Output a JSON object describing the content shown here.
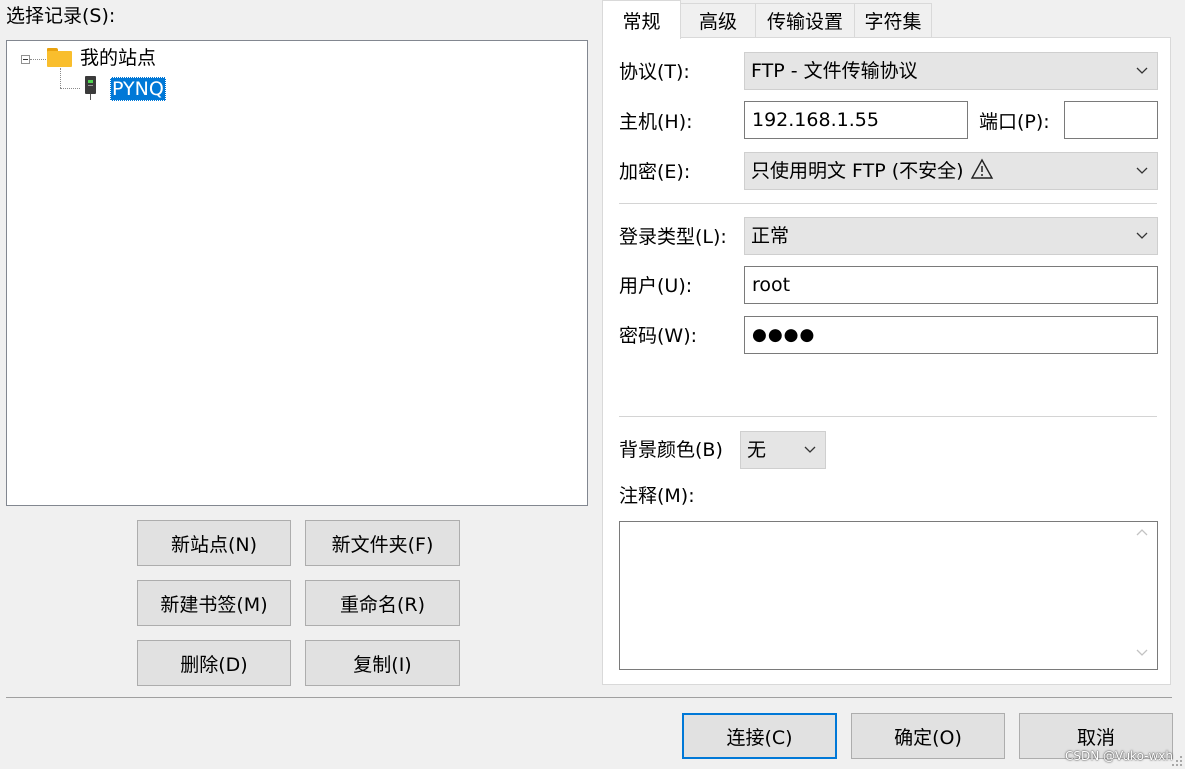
{
  "site_list": {
    "label": "选择记录(S):",
    "root_folder": "我的站点",
    "selected_site": "PYNQ"
  },
  "buttons": {
    "new_site": "新站点(N)",
    "new_folder": "新文件夹(F)",
    "new_bookmark": "新建书签(M)",
    "rename": "重命名(R)",
    "delete": "删除(D)",
    "copy": "复制(I)",
    "connect": "连接(C)",
    "ok": "确定(O)",
    "cancel": "取消"
  },
  "tabs": [
    "常规",
    "高级",
    "传输设置",
    "字符集"
  ],
  "general": {
    "protocol_label": "协议(T):",
    "protocol_value": "FTP - 文件传输协议",
    "host_label": "主机(H):",
    "host_value": "192.168.1.55",
    "port_label": "端口(P):",
    "port_value": "",
    "encryption_label": "加密(E):",
    "encryption_value": "只使用明文 FTP (不安全)",
    "logon_type_label": "登录类型(L):",
    "logon_type_value": "正常",
    "user_label": "用户(U):",
    "user_value": "root",
    "password_label": "密码(W):",
    "password_value": "●●●●",
    "bg_color_label": "背景颜色(B)",
    "bg_color_value": "无",
    "comments_label": "注释(M):",
    "comments_value": ""
  },
  "icons": {
    "tree_collapse": "minus-box-icon",
    "folder": "folder-icon",
    "server": "server-icon",
    "warning": "warning-triangle-icon",
    "dropdown": "chevron-down-icon"
  },
  "colors": {
    "selection": "#0078d7",
    "button_face": "#e1e1e1",
    "window_bg": "#f0f0f0",
    "folder": "#f9be2d"
  },
  "watermark": "CSDN @Vuko-wxh"
}
